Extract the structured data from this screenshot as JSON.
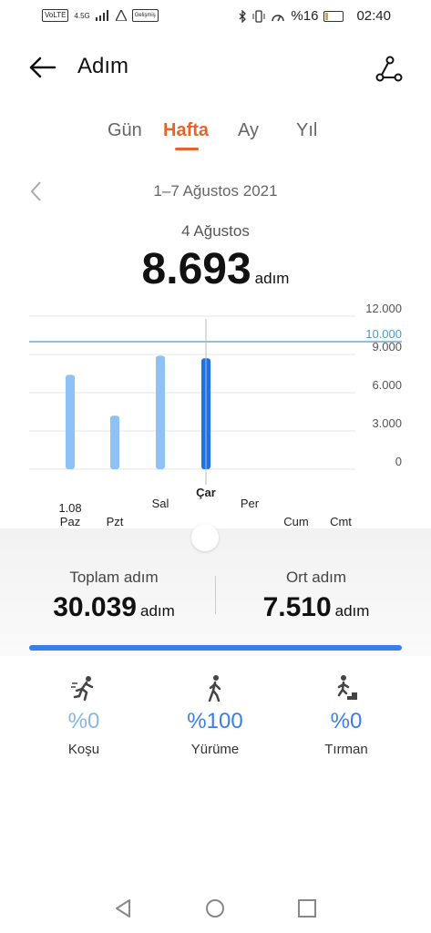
{
  "status_bar": {
    "network_label": "VoLTE",
    "signal_label": "4.5G",
    "extra_label": "Gelişmiş",
    "battery_text": "%16",
    "battery_level": 0.16,
    "time": "02:40"
  },
  "header": {
    "title": "Adım"
  },
  "tabs": [
    {
      "label": "Gün"
    },
    {
      "label": "Hafta"
    },
    {
      "label": "Ay"
    },
    {
      "label": "Yıl"
    }
  ],
  "active_tab": 1,
  "range": {
    "label": "1–7 Ağustos 2021"
  },
  "selected": {
    "date": "4 Ağustos",
    "value": "8.693",
    "unit": "adım"
  },
  "colors": {
    "accent": "#e8632a",
    "bar": "#8ec2f5",
    "bar_selected": "#1a73e8",
    "goal_line": "#4a9bd1",
    "blue_text": "#3b7ee8",
    "light_blue_text": "#87b6e6"
  },
  "chart_data": {
    "type": "bar",
    "categories": [
      "Paz",
      "Pzt",
      "Sal",
      "Çar",
      "Per",
      "Cum",
      "Cmt"
    ],
    "values": [
      7400,
      4200,
      8900,
      8693,
      0,
      0,
      0
    ],
    "selected_index": 3,
    "ylim": [
      0,
      12000
    ],
    "yticks": [
      0,
      3000,
      6000,
      9000,
      12000
    ],
    "ytick_labels": [
      "0",
      "3.000",
      "6.000",
      "9.000",
      "12.000"
    ],
    "goal": 10000,
    "goal_label": "10.000",
    "date_label": "1.08"
  },
  "summary": {
    "total_label": "Toplam adım",
    "total_value": "30.039",
    "total_unit": "adım",
    "avg_label": "Ort adım",
    "avg_value": "7.510",
    "avg_unit": "adım"
  },
  "activities": [
    {
      "label": "Koşu",
      "percent": "%0",
      "icon": "running-icon"
    },
    {
      "label": "Yürüme",
      "percent": "%100",
      "icon": "walking-icon"
    },
    {
      "label": "Tırman",
      "percent": "%0",
      "icon": "climbing-icon"
    }
  ]
}
